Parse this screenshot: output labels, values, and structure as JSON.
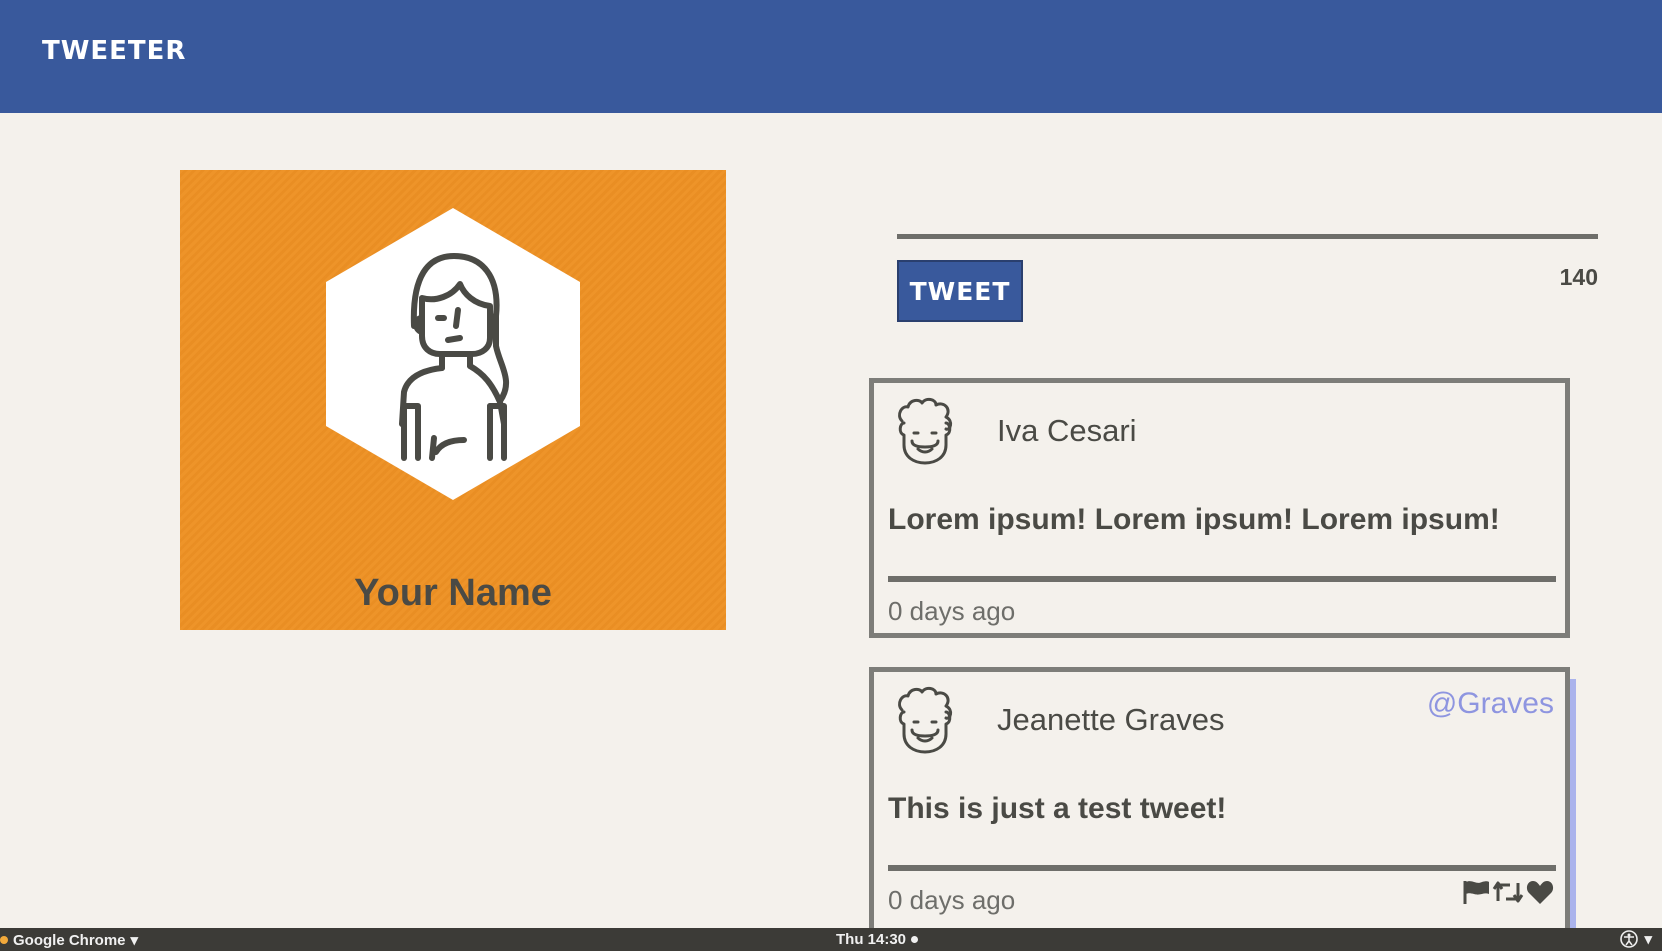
{
  "navbar": {
    "brand": "TWEETER"
  },
  "profile": {
    "name": "Your Name",
    "avatar_icon": "user-avatar-icon",
    "card_color": "#ee9124"
  },
  "compose": {
    "button_label": "TWEET",
    "char_count": "140"
  },
  "tweets": [
    {
      "author": "Iva Cesari",
      "handle": "",
      "text": "Lorem ipsum! Lorem ipsum! Lorem ipsum!",
      "time": "0 days ago",
      "avatar_icon": "user-avatar-icon"
    },
    {
      "author": "Jeanette Graves",
      "handle": "@Graves",
      "text": "This is just a test tweet!",
      "time": "0 days ago",
      "avatar_icon": "user-avatar-icon",
      "actions": [
        "flag-icon",
        "retweet-icon",
        "heart-icon"
      ]
    }
  ],
  "taskbar": {
    "app_name": "Google Chrome",
    "clock": "Thu 14:30"
  },
  "colors": {
    "primary": "#39599c",
    "background": "#f4f1ec",
    "text": "#4a4a45",
    "handle": "#8e95e0",
    "accent_orange": "#ee9124"
  }
}
